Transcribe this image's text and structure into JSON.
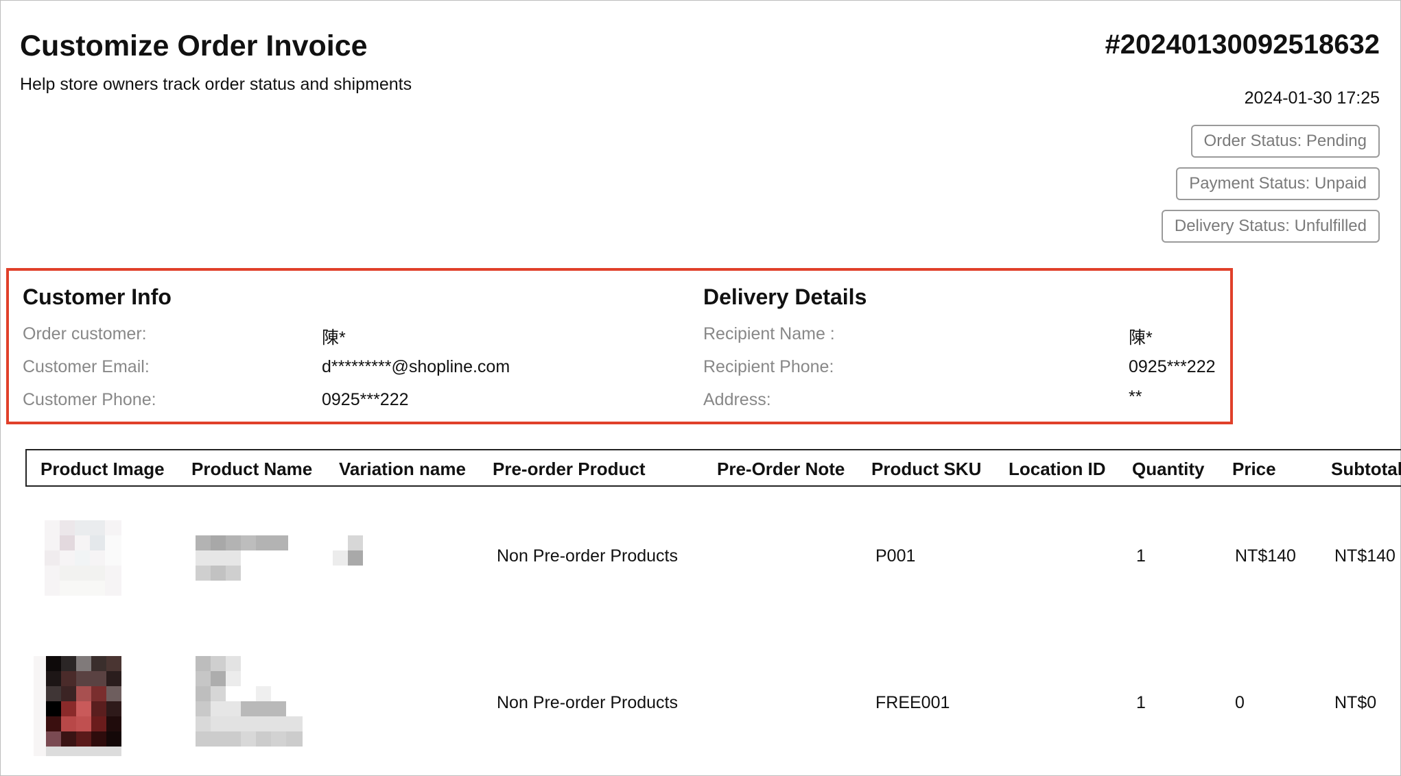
{
  "header": {
    "title": "Customize Order Invoice",
    "subtitle": "Help store owners track order status and shipments",
    "order_number": "#20240130092518632",
    "order_date": "2024-01-30 17:25",
    "statuses": {
      "order": "Order Status: Pending",
      "payment": "Payment Status: Unpaid",
      "delivery": "Delivery Status: Unfulfilled"
    }
  },
  "customer_info": {
    "title": "Customer Info",
    "fields": [
      {
        "label": "Order customer:",
        "value": "陳*"
      },
      {
        "label": "Customer Email:",
        "value": "d*********@shopline.com"
      },
      {
        "label": "Customer Phone:",
        "value": "0925***222"
      }
    ]
  },
  "delivery_details": {
    "title": "Delivery Details",
    "fields": [
      {
        "label": "Recipient Name :",
        "value": "陳*"
      },
      {
        "label": "Recipient Phone:",
        "value": "0925***222"
      },
      {
        "label": "Address:",
        "value": "**"
      }
    ]
  },
  "table": {
    "columns": [
      "Product Image",
      "Product Name",
      "Variation name",
      "Pre-order Product",
      "Pre-Order Note",
      "Product SKU",
      "Location ID",
      "Quantity",
      "Price",
      "Subtotal"
    ],
    "rows": [
      {
        "preorder": "Non Pre-order Products",
        "sku": "P001",
        "quantity": "1",
        "price": "NT$140",
        "subtotal": "NT$140"
      },
      {
        "preorder": "Non Pre-order Products",
        "sku": "FREE001",
        "quantity": "1",
        "price": "0",
        "subtotal": "NT$0"
      }
    ]
  },
  "colors": {
    "highlight_border": "#e0402a",
    "badge_border": "#9a9a9a",
    "label_gray": "#888888"
  }
}
